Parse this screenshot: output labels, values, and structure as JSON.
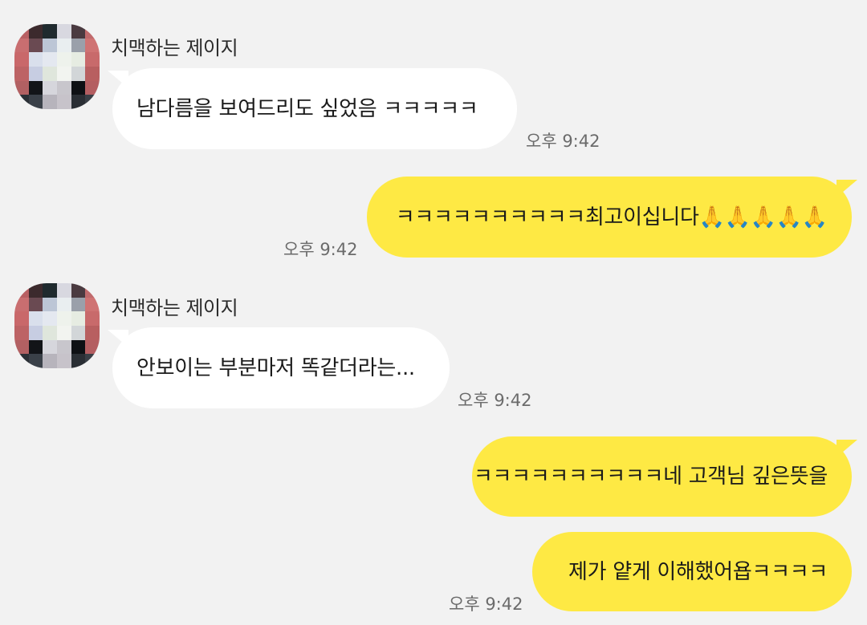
{
  "chat": {
    "messages": [
      {
        "direction": "incoming",
        "sender": "치맥하는 제이지",
        "text": "남다름을 보여드리도 싶었음 ㅋㅋㅋㅋㅋ",
        "time": "오후 9:42"
      },
      {
        "direction": "outgoing",
        "text": "ㅋㅋㅋㅋㅋㅋㅋㅋㅋㅋ최고이십니다🙏🙏🙏🙏🙏",
        "time": "오후 9:42"
      },
      {
        "direction": "incoming",
        "sender": "치맥하는 제이지",
        "text": "안보이는 부분마저 똑같더라는...",
        "time": "오후 9:42"
      },
      {
        "direction": "outgoing",
        "text": "ㅋㅋㅋㅋㅋㅋㅋㅋㅋㅋ네 고객님 깊은뜻을",
        "time": ""
      },
      {
        "direction": "outgoing",
        "text": "제가 얕게 이해했어욥ㅋㅋㅋㅋ",
        "time": "오후 9:42"
      }
    ]
  },
  "colors": {
    "background": "#f2f2f2",
    "incoming_bubble": "#ffffff",
    "outgoing_bubble": "#fee944",
    "timestamp": "#6b6b6b"
  },
  "icons": {
    "avatar": "pixelated-profile-avatar"
  }
}
